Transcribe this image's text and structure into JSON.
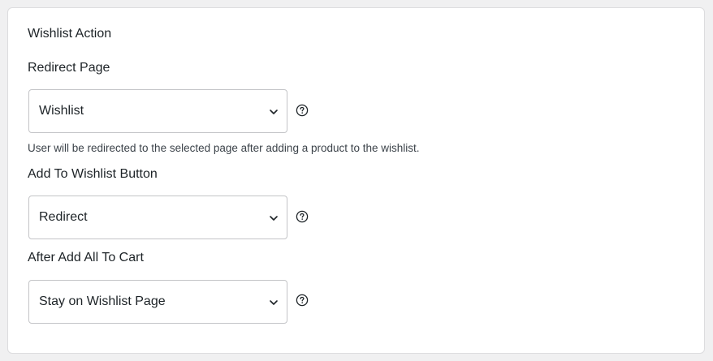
{
  "section": {
    "title": "Wishlist Action"
  },
  "fields": [
    {
      "label": "Redirect Page",
      "selected": "Wishlist",
      "description": "User will be redirected to the selected page after adding a product to the wishlist."
    },
    {
      "label": "Add To Wishlist Button",
      "selected": "Redirect"
    },
    {
      "label": "After Add All To Cart",
      "selected": "Stay on Wishlist Page"
    }
  ],
  "icons": {
    "dropdown": "chevron-down-icon",
    "help": "question-circle-icon"
  },
  "colors": {
    "border": "#c3c4c7",
    "text": "#1d2327",
    "muted": "#3c434a",
    "background": "#f0f0f1"
  }
}
